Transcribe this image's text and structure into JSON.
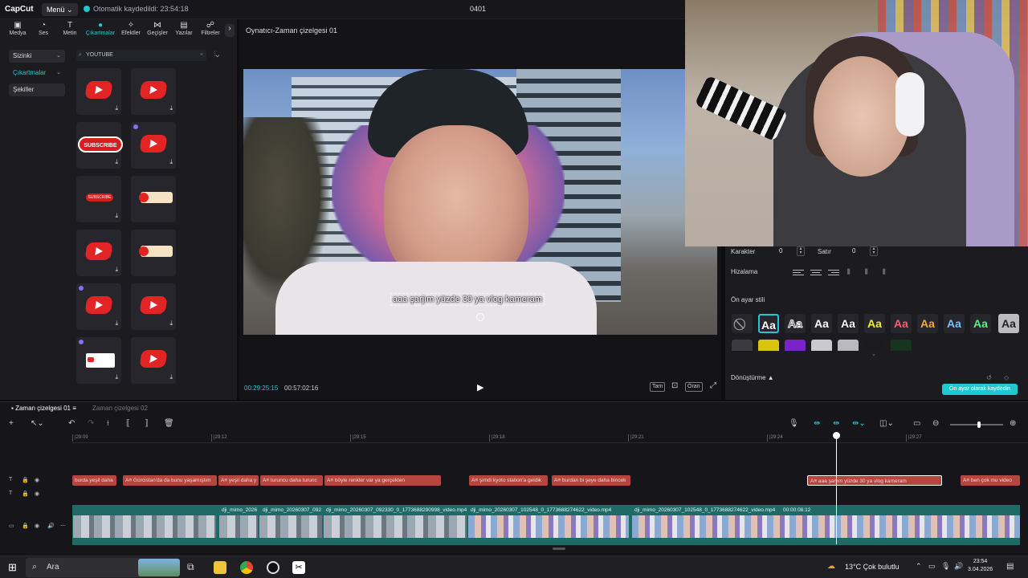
{
  "topbar": {
    "logo": "CapCut",
    "menu": "Menü",
    "autosave": "Otomatik kaydedildi: 23:54:18",
    "project_title": "0401"
  },
  "tabs": [
    {
      "label": "Medya",
      "icon": "media-icon"
    },
    {
      "label": "Ses",
      "icon": "audio-icon"
    },
    {
      "label": "Metin",
      "icon": "text-icon"
    },
    {
      "label": "Çıkartmalar",
      "icon": "sticker-icon"
    },
    {
      "label": "Efektler",
      "icon": "effects-icon"
    },
    {
      "label": "Geçişler",
      "icon": "transitions-icon"
    },
    {
      "label": "Yazılar",
      "icon": "captions-icon"
    },
    {
      "label": "Filtreler",
      "icon": "filters-icon"
    }
  ],
  "categories": [
    "Sizinki",
    "Çıkartmalar",
    "Şekiller"
  ],
  "search": {
    "value": "YOUTUBE"
  },
  "sticker_labels": {
    "subscribe_big": "SUBSCRIBE",
    "subscribe_small": "SUBSCRIBE"
  },
  "player": {
    "title": "Oynatıcı-Zaman çizelgesi 01",
    "caption": "aaa şarjım yüzde 30 ya vlog kameram",
    "current_time": "00:29:25:15",
    "total_time": "00:57:02:16",
    "ctrl_full": "Tam",
    "ctrl_ratio": "Oran"
  },
  "text_props": {
    "karakter_label": "Karakter",
    "karakter_value": "0",
    "satir_label": "Satır",
    "satir_value": "0",
    "hizalama_label": "Hizalama",
    "preset_label": "Ön ayar stili",
    "preset_sample": "Aa",
    "preset_colors": [
      "#ffffff",
      "#ffffff",
      "#ffffff",
      "#ffffff",
      "#f3ea3a",
      "#ff5a6e",
      "#ffa53a",
      "#6fc3ff",
      "#5df07a",
      "#ffffff"
    ],
    "donusturme_label": "Dönüştürme",
    "save_preset": "Ön ayar olarak kaydedin"
  },
  "timeline": {
    "tab1": "Zaman çizelgesi 01",
    "tab2": "Zaman çizelgesi 02",
    "ticks": [
      "|29:09",
      "|29:12",
      "|29:15",
      "|29:18",
      "|29:21",
      "|29:24",
      "|29:27"
    ],
    "text_clips": [
      "burda yeşil daha",
      "A≡ Gürcistan'da da bunu yaşamıştım",
      "A≡ yeşil daha y",
      "A≡ turuncu daha turunc",
      "A≡ böyle renkler var ya gerçekten",
      "A≡ şimdi kyoto station'a geldik",
      "A≡ burdan bi şeye daha bincek",
      "A≡ aaa şarjım yüzde 30 ya vlog kameram",
      "A≡ ben çok mu video"
    ],
    "video_clips": [
      "dji_mimo_2026",
      "dji_mimo_20260307_092",
      "dji_mimo_20260307_092330_0_1773688290998_video.mp4",
      "dji_mimo_20260307_102548_0_1773688274622_video.mp4",
      "dji_mimo_20260307_102548_0_1773688274622_video.mp4",
      "00:00:08:12"
    ]
  },
  "taskbar": {
    "search": "Ara",
    "weather": "13°C  Çok bulutlu",
    "time": "23:54",
    "date": "3.04.2026"
  },
  "colors": {
    "accent": "#22c8cf",
    "text_clip": "#b5463f",
    "video_track": "#1f6a66"
  }
}
